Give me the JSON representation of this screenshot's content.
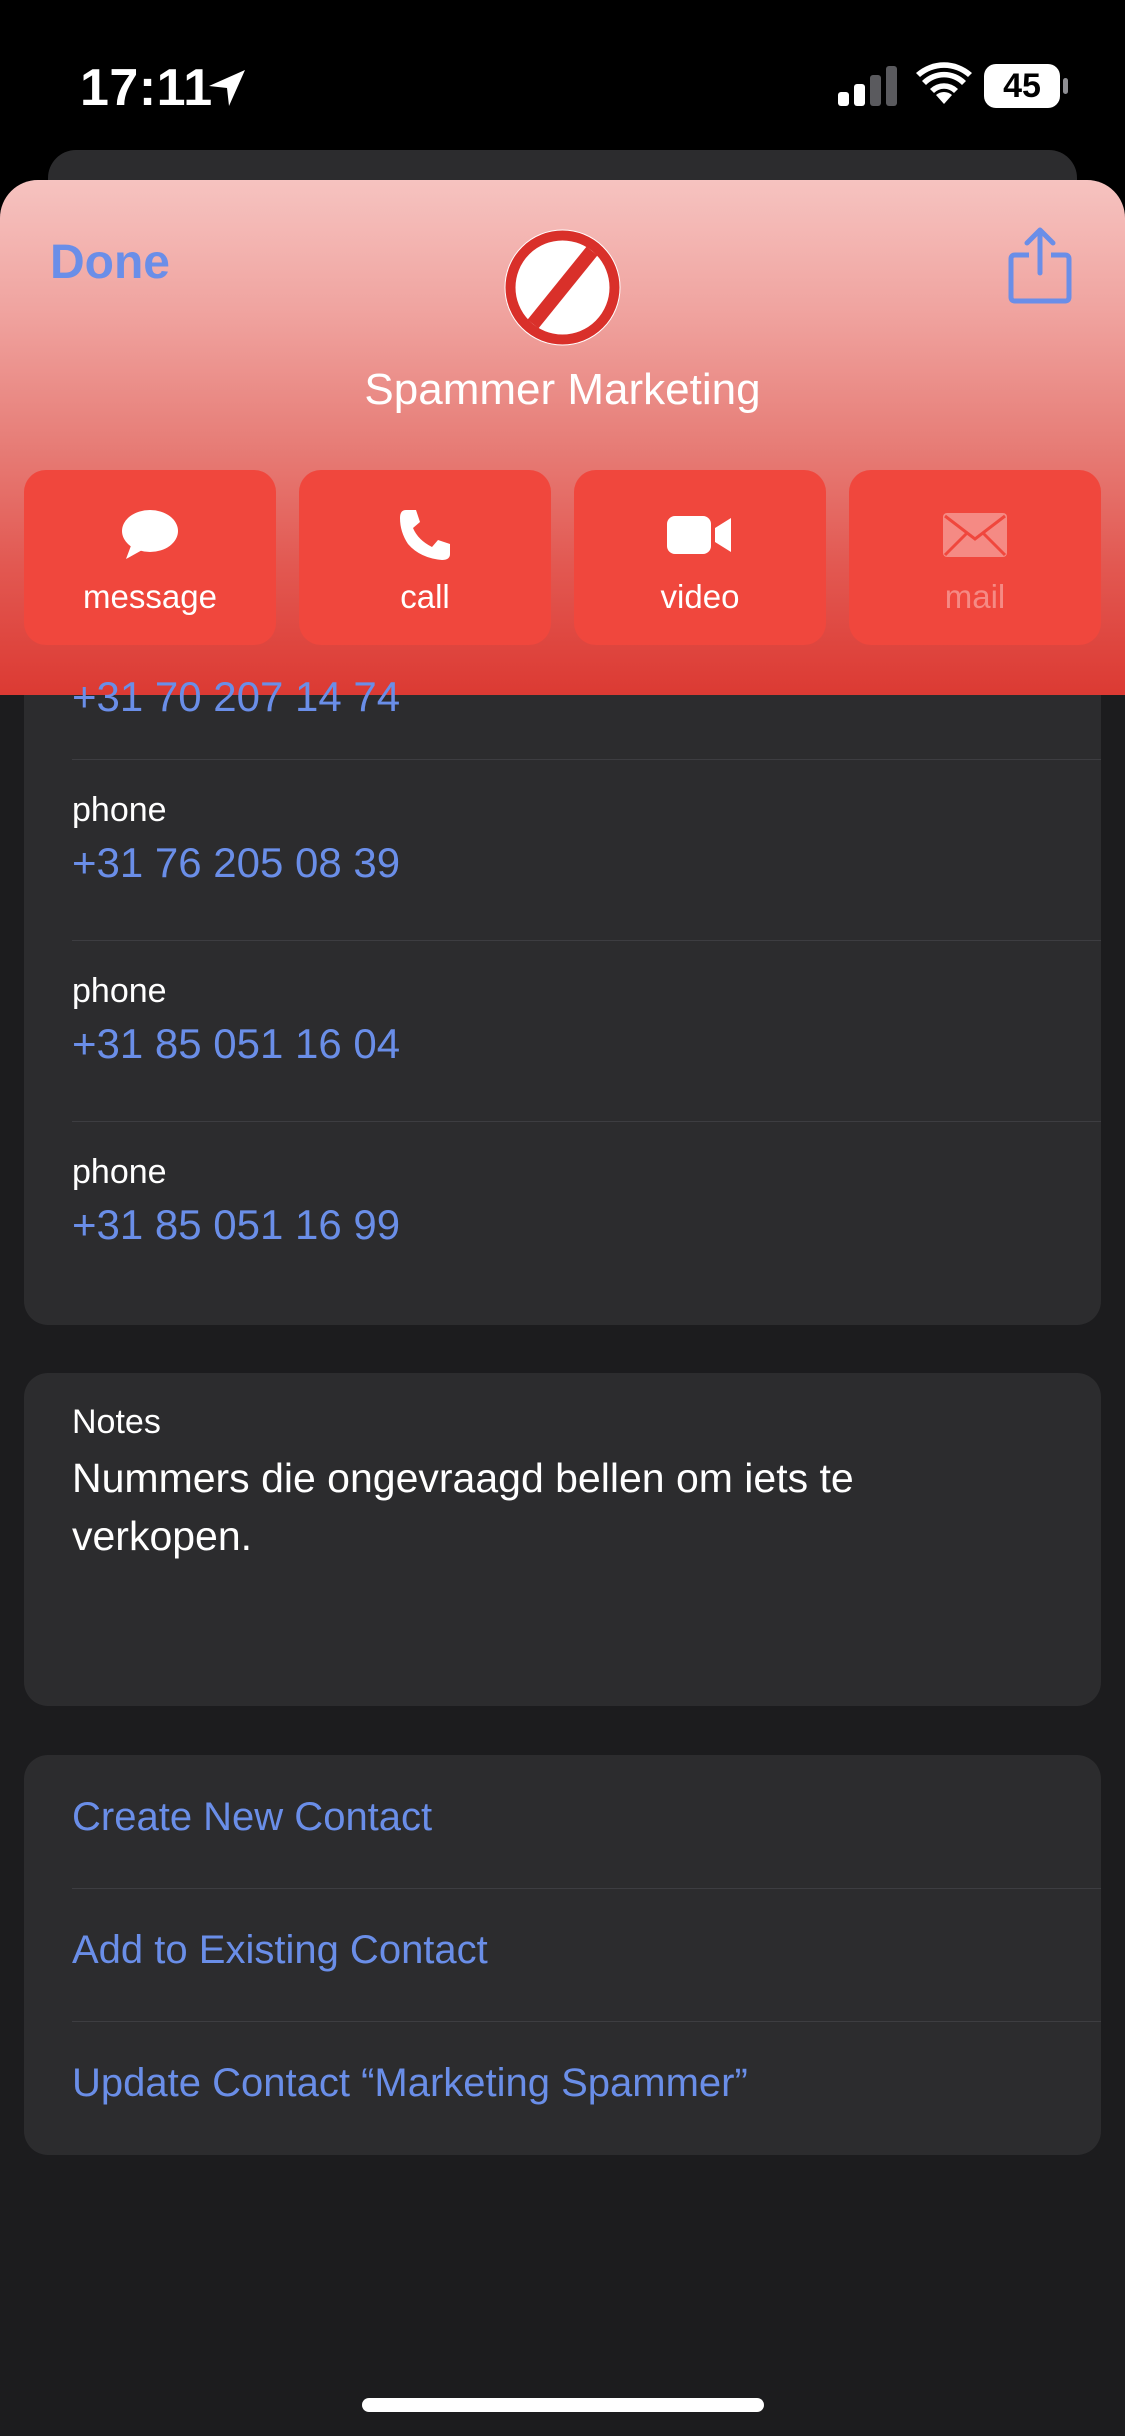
{
  "status_bar": {
    "time": "17:11",
    "battery": "45"
  },
  "header": {
    "done_label": "Done",
    "contact_name": "Spammer Marketing",
    "gradient_top": "#f6c3c0",
    "gradient_bottom": "#dc3a33"
  },
  "actions": [
    {
      "label": "message",
      "icon": "message-bubble-icon"
    },
    {
      "label": "call",
      "icon": "phone-icon"
    },
    {
      "label": "video",
      "icon": "video-camera-icon"
    },
    {
      "label": "mail",
      "icon": "envelope-icon",
      "disabled": true
    }
  ],
  "phones": [
    {
      "label": "",
      "number": "+31 70 207 14 74"
    },
    {
      "label": "phone",
      "number": "+31 76 205 08 39"
    },
    {
      "label": "phone",
      "number": "+31 85 051 16 04"
    },
    {
      "label": "phone",
      "number": "+31 85 051 16 99"
    }
  ],
  "notes": {
    "label": "Notes",
    "text": "Nummers die ongevraagd bellen om iets te verkopen."
  },
  "links": [
    "Create New Contact",
    "Add to Existing Contact",
    "Update Contact “Marketing Spammer”"
  ],
  "colors": {
    "accent_link": "#6a8ee8",
    "action_button": "#f0473d",
    "card_bg": "#2c2c2e",
    "page_bg": "#1c1c1e"
  }
}
